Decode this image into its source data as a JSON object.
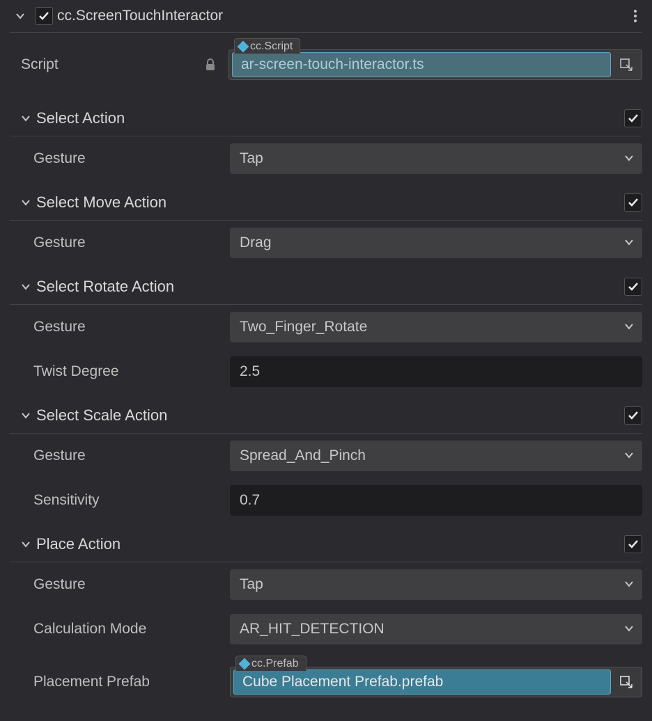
{
  "component": {
    "title": "cc.ScreenTouchInteractor",
    "enabled": true
  },
  "script": {
    "label": "Script",
    "tag": "cc.Script",
    "value": "ar-screen-touch-interactor.ts"
  },
  "sections": {
    "selectAction": {
      "title": "Select Action",
      "enabled": true,
      "gestureLabel": "Gesture",
      "gesture": "Tap"
    },
    "selectMoveAction": {
      "title": "Select Move Action",
      "enabled": true,
      "gestureLabel": "Gesture",
      "gesture": "Drag"
    },
    "selectRotateAction": {
      "title": "Select Rotate Action",
      "enabled": true,
      "gestureLabel": "Gesture",
      "gesture": "Two_Finger_Rotate",
      "twistLabel": "Twist Degree",
      "twist": "2.5"
    },
    "selectScaleAction": {
      "title": "Select Scale Action",
      "enabled": true,
      "gestureLabel": "Gesture",
      "gesture": "Spread_And_Pinch",
      "sensitivityLabel": "Sensitivity",
      "sensitivity": "0.7"
    },
    "placeAction": {
      "title": "Place Action",
      "enabled": true,
      "gestureLabel": "Gesture",
      "gesture": "Tap",
      "calcModeLabel": "Calculation Mode",
      "calcMode": "AR_HIT_DETECTION",
      "prefabLabel": "Placement Prefab",
      "prefabTag": "cc.Prefab",
      "prefabValue": "Cube Placement Prefab.prefab"
    }
  }
}
